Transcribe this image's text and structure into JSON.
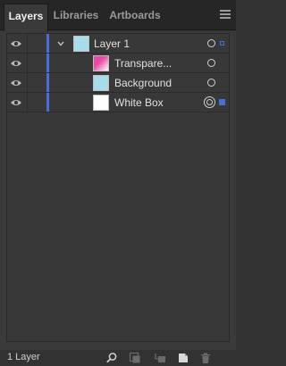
{
  "tabs": [
    {
      "label": "Layers",
      "active": true
    },
    {
      "label": "Libraries",
      "active": false
    },
    {
      "label": "Artboards",
      "active": false
    }
  ],
  "layers": {
    "top": {
      "name": "Layer 1",
      "color": "#4a6ed8",
      "expanded": true
    },
    "items": [
      {
        "name": "Transpare...",
        "thumb": "pink-gradient"
      },
      {
        "name": "Background",
        "thumb": "light-blue"
      },
      {
        "name": "White Box",
        "thumb": "white",
        "selected": true
      }
    ]
  },
  "footer": {
    "count": "1 Layer",
    "icons": [
      "search-icon",
      "make-clipping-mask-icon",
      "create-sublayer-icon",
      "new-layer-icon",
      "delete-icon"
    ]
  },
  "colors": {
    "accent": "#4a6ed8",
    "panel": "#323232"
  }
}
